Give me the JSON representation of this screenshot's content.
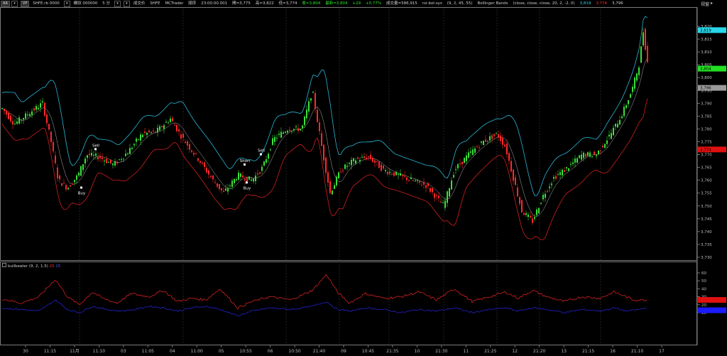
{
  "toolbar": {
    "profile_button": "AA",
    "mode_button": "VP",
    "symbol_code": "SHFE.rb 0000",
    "commodity_label": "螺纹 000000",
    "interval_label": "5 分",
    "session_label": "成交价",
    "exchange_label": "SHFE",
    "datasource_label": "MCTrader",
    "mode_text": "順序",
    "time": "23:00:00.001",
    "open": "開=3,775",
    "high": "高=3,822",
    "low": "低=3,774",
    "close": "收=3,804",
    "last": "最新=3,804",
    "change": "+29",
    "change_pct": "+0.77%",
    "volume": "成交量=586,915",
    "strategy_label": "rsi-bol-sys",
    "strategy_params": "(9, 2, 45, 55)",
    "bb_label": "Bollinger Bands",
    "bb_params": "(close, close, close, 20, 2, -2, 0)",
    "bb_upper_value": "3,819",
    "bb_lower_value": "3,774",
    "bb_mid_value": "3,796",
    "window_menu": "视窗"
  },
  "colors": {
    "bull": "#3adf3a",
    "bear": "#ff2a2a",
    "upper_band": "#29b8d6",
    "lower_band": "#d11f1f",
    "mid_band": "#b0b0b0",
    "ind_red": "#d12020",
    "ind_blue": "#2222cc"
  },
  "price_axis": {
    "ticks": [
      "3,820",
      "3,815",
      "3,810",
      "3,805",
      "3,800",
      "3,795",
      "3,790",
      "3,785",
      "3,780",
      "3,775",
      "3,770",
      "3,765",
      "3,760",
      "3,755",
      "3,750",
      "3,745",
      "3,740",
      "3,735",
      "3,730"
    ],
    "badges": [
      {
        "label": "3,819",
        "color": "#28d7e8",
        "value": 3818.5
      },
      {
        "label": "3,804",
        "color": "#22e022",
        "value": 3803.5
      },
      {
        "label": "3,796",
        "color": "#9a9a9a",
        "value": 3796
      },
      {
        "label": "3,774",
        "color": "#e01010",
        "value": 3772
      }
    ]
  },
  "indicator": {
    "name": "bullbeater",
    "params": "(9, 2, 1.5)",
    "value1": "25",
    "value2": "15",
    "ticks": [
      "60",
      "50",
      "40",
      "30",
      "20",
      "10"
    ],
    "badges": [
      {
        "label": "",
        "color": "#e01010",
        "value": 26
      },
      {
        "label": "",
        "color": "#1b1bff",
        "value": 13
      }
    ]
  },
  "time_axis": {
    "labels": [
      "30",
      "11:15",
      "11月",
      "11:10",
      "03",
      "11:05",
      "04",
      "11:00",
      "05",
      "10:55",
      "06",
      "10:50",
      "21:40",
      "09",
      "10:45",
      "21:35",
      "10",
      "21:30",
      "11",
      "21:25",
      "12",
      "21:20",
      "13",
      "21:15",
      "16",
      "21:10",
      "17"
    ]
  },
  "signals": [
    {
      "label": "Sell",
      "type": "sell"
    },
    {
      "label": "Buy",
      "type": "buy"
    },
    {
      "label": "Short",
      "type": "sell"
    },
    {
      "label": "Buy",
      "type": "buy"
    },
    {
      "label": "Sell",
      "type": "sell"
    }
  ]
}
